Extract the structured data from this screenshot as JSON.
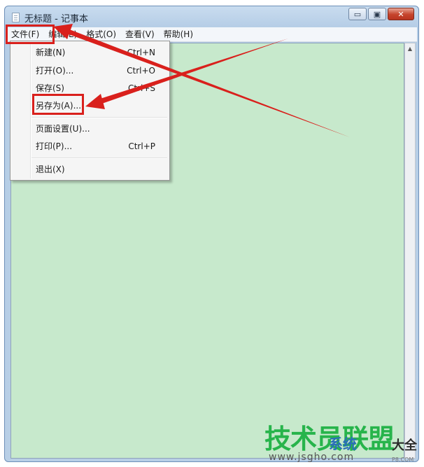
{
  "window": {
    "title": "无标题 - 记事本",
    "buttons": {
      "minimize": "▭",
      "maximize": "▣",
      "close": "✕"
    }
  },
  "menubar": [
    {
      "id": "file",
      "label": "文件(F)"
    },
    {
      "id": "edit",
      "label": "编辑(E)"
    },
    {
      "id": "format",
      "label": "格式(O)"
    },
    {
      "id": "view",
      "label": "查看(V)"
    },
    {
      "id": "help",
      "label": "帮助(H)"
    }
  ],
  "file_menu": [
    {
      "label": "新建(N)",
      "shortcut": "Ctrl+N"
    },
    {
      "label": "打开(O)...",
      "shortcut": "Ctrl+O"
    },
    {
      "label": "保存(S)",
      "shortcut": "Ctrl+S"
    },
    {
      "label": "另存为(A)...",
      "shortcut": ""
    },
    {
      "label": "页面设置(U)...",
      "shortcut": ""
    },
    {
      "label": "打印(P)...",
      "shortcut": "Ctrl+P"
    },
    {
      "label": "退出(X)",
      "shortcut": ""
    }
  ],
  "watermark": {
    "main": "技术员联盟",
    "blue": "系统",
    "dark": "大全",
    "url": "www.jsgho.com",
    "small": "P8.COM"
  },
  "colors": {
    "annotation": "#d9201c",
    "editor_bg": "#c7e9cc",
    "watermark_green": "#27b44b"
  },
  "icons": {
    "minimize": "minimize-icon",
    "maximize": "maximize-icon",
    "close": "close-icon",
    "app": "notepad-icon",
    "scroll_up": "scroll-up-arrow-icon"
  }
}
